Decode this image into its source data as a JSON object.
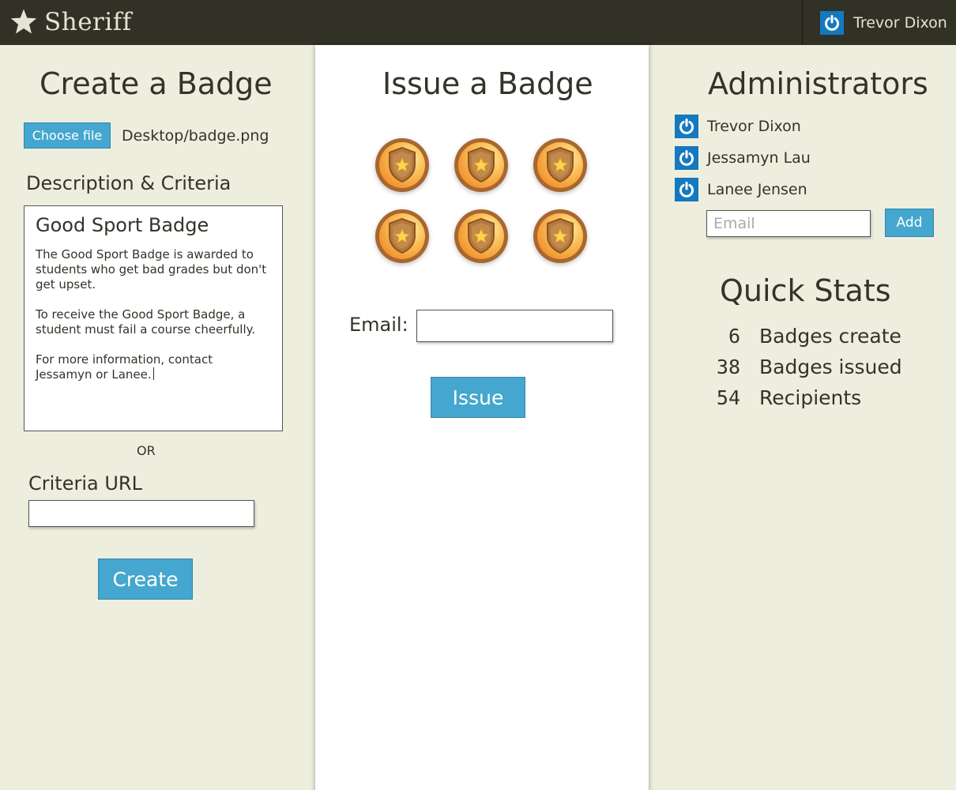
{
  "header": {
    "app_name": "Sheriff",
    "user_name": "Trevor Dixon"
  },
  "create": {
    "title": "Create a Badge",
    "choose_file_label": "Choose file",
    "file_path": "Desktop/badge.png",
    "description_label": "Description & Criteria",
    "description_title": "Good Sport Badge",
    "description_paragraphs": [
      "The Good Sport Badge is awarded to students who get bad grades but don't get upset.",
      "To receive the Good Sport Badge, a student must fail a course cheerfully.",
      "For more information, contact Jessamyn or Lanee."
    ],
    "or_label": "OR",
    "criteria_url_label": "Criteria URL",
    "criteria_url_value": "",
    "create_label": "Create"
  },
  "issue": {
    "title": "Issue a Badge",
    "badge_count": 6,
    "email_label": "Email:",
    "email_value": "",
    "issue_label": "Issue"
  },
  "admins": {
    "title": "Administrators",
    "list": [
      "Trevor Dixon",
      "Jessamyn Lau",
      "Lanee Jensen"
    ],
    "email_placeholder": "Email",
    "add_label": "Add"
  },
  "stats": {
    "title": "Quick Stats",
    "rows": [
      {
        "value": "6",
        "label": "Badges create"
      },
      {
        "value": "38",
        "label": "Badges issued"
      },
      {
        "value": "54",
        "label": "Recipients"
      }
    ]
  },
  "colors": {
    "topbar": "#313125",
    "background": "#eeeedf",
    "button": "#45a7cf",
    "avatar": "#1479bf",
    "badge_rim": "#a8672f",
    "badge_face": "#f6a93c"
  },
  "icons": {
    "brand": "star-icon",
    "avatar": "power-icon",
    "badge": "shield-star-badge-icon"
  }
}
